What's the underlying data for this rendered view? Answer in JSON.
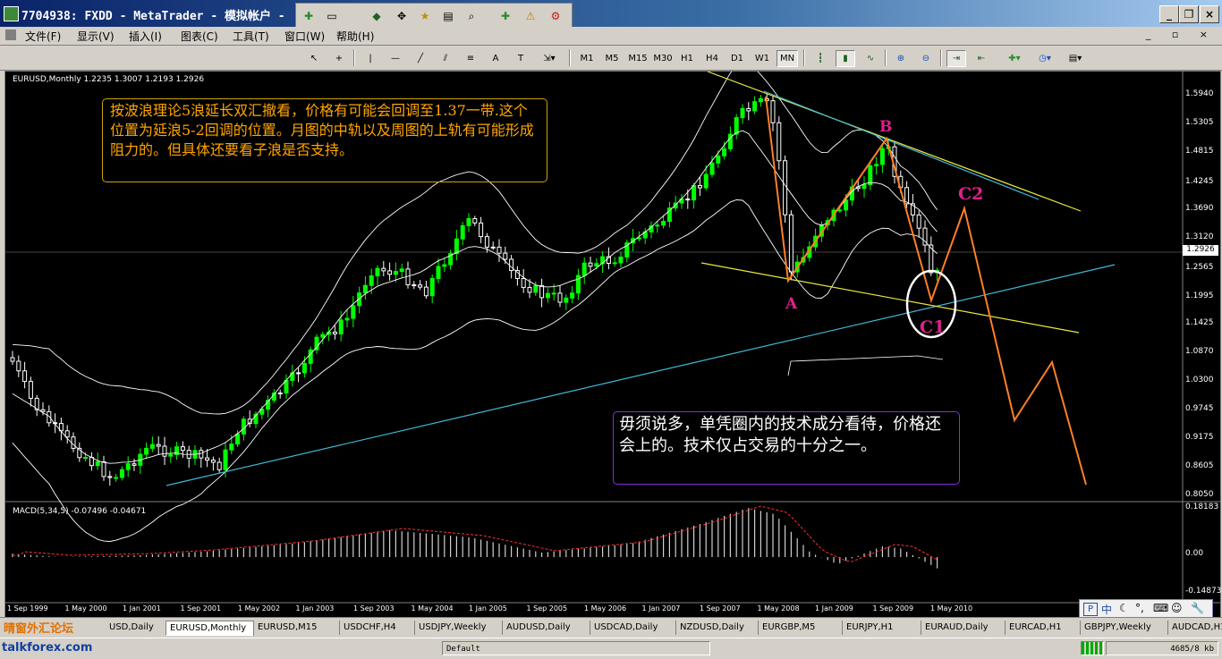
{
  "window": {
    "title": "7704938: FXDD - MetaTrader - 模拟帐户 -",
    "controls": [
      "minimize",
      "restore",
      "close"
    ]
  },
  "menu": [
    "文件(F)",
    "显示(V)",
    "插入(I)",
    "图表(C)",
    "工具(T)",
    "窗口(W)",
    "帮助(H)"
  ],
  "mdi_controls": "_ ▫ ×",
  "timeframes": [
    "M1",
    "M5",
    "M15",
    "M30",
    "H1",
    "H4",
    "D1",
    "W1",
    "MN"
  ],
  "active_timeframe": "MN",
  "chart": {
    "symbol_line": "EURUSD,Monthly  1.2235 1.3007 1.2193 1.2926",
    "macd_line": "MACD(5,34,5) -0.07496 -0.04671",
    "current_price": "1.2926",
    "price_ticks": [
      "1.5940",
      "1.5305",
      "1.4815",
      "1.4245",
      "1.3690",
      "1.3120",
      "1.2565",
      "1.1995",
      "1.1425",
      "1.0870",
      "1.0300",
      "0.9745",
      "0.9175",
      "0.8605",
      "0.8050"
    ],
    "macd_ticks": [
      "0.18183",
      "0.00",
      "-0.14873"
    ],
    "date_ticks": [
      "1 Sep 1999",
      "1 May 2000",
      "1 Jan 2001",
      "1 Sep 2001",
      "1 May 2002",
      "1 Jan 2003",
      "1 Sep 2003",
      "1 May 2004",
      "1 Jan 2005",
      "1 Sep 2005",
      "1 May 2006",
      "1 Jan 2007",
      "1 Sep 2007",
      "1 May 2008",
      "1 Jan 2009",
      "1 Sep 2009",
      "1 May 2010"
    ],
    "note_top": "按波浪理论5浪延长双汇撤看，价格有可能会回调至1.37一带.这个位置为延浪5-2回调的位置。月图的中轨以及周图的上轨有可能形成阻力的。但具体还要看子浪是否支持。",
    "note_bottom": "毋须说多，单凭圈内的技术成分看待，价格还会上的。技术仅占交易的十分之一。",
    "wave_labels": {
      "a": "A",
      "b": "B",
      "c1": "C1",
      "c2": "C2"
    },
    "colors": {
      "bull": "#00ff00",
      "bear": "#ffffff",
      "trend_cyan": "#3fb8d8",
      "trend_yellow": "#e8e840",
      "projection": "#ff7f27",
      "wave_label": "#e0208c"
    }
  },
  "tabs": [
    "USD,Daily",
    "EURUSD,Monthly",
    "EURUSD,M15",
    "USDCHF,H4",
    "USDJPY,Weekly",
    "AUDUSD,Daily",
    "USDCAD,Daily",
    "NZDUSD,Daily",
    "EURGBP,M5",
    "EURJPY,H1",
    "EURAUD,Daily",
    "EURCAD,H1",
    "GBPJPY,Weekly",
    "AUDCAD,H1"
  ],
  "status": {
    "profile": "Default",
    "traffic": "4685/8 kb"
  },
  "watermark": {
    "cn": "晴窗外汇论坛",
    "url": "talkforex.com"
  },
  "ime": "中"
}
